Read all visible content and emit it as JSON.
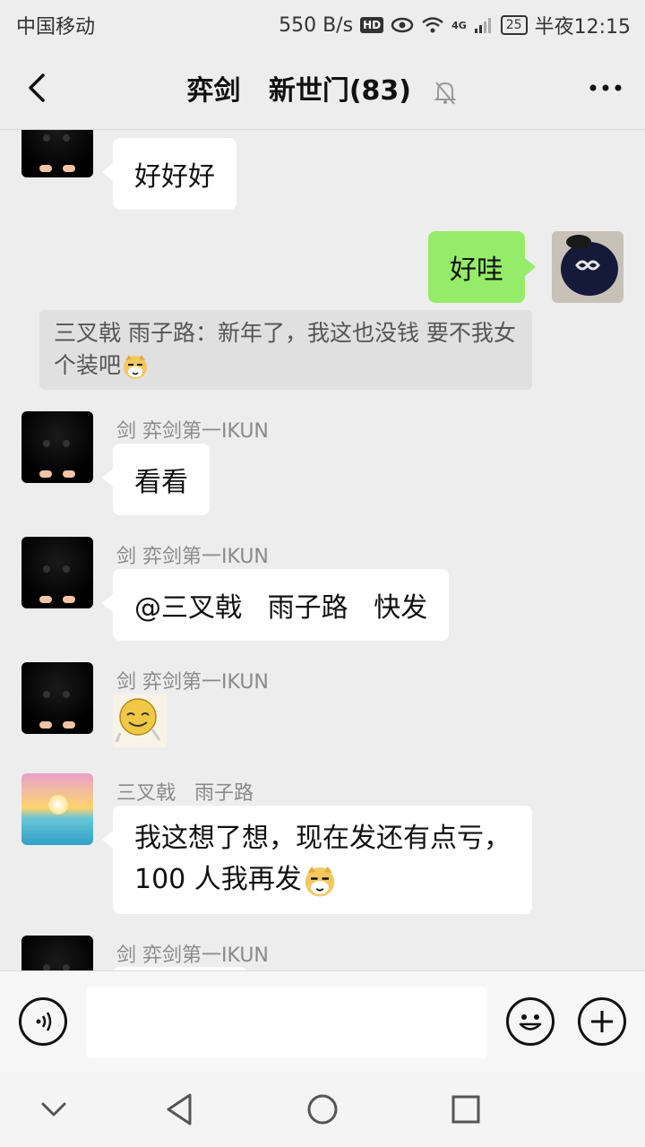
{
  "status_bar": {
    "carrier": "中国移动",
    "net_speed": "550 B/s",
    "hd": "HD",
    "signal_type": "4G",
    "battery": "25",
    "time": "半夜12:15"
  },
  "header": {
    "title": "弈剑   新世门(83)",
    "back_icon": "chevron-left-icon",
    "mute_icon": "bell-off-icon",
    "more_icon": "more-dots-icon"
  },
  "messages": [
    {
      "type": "received",
      "avatar": "cat",
      "sender": "",
      "text": "好好好"
    },
    {
      "type": "sent",
      "avatar": "me",
      "text": "好哇"
    },
    {
      "type": "quote",
      "text": "三叉戟   雨子路：新年了，我这也没钱 要不我女个装吧"
    },
    {
      "type": "received",
      "avatar": "cat",
      "sender": "剑 弈剑第一IKUN",
      "text": "看看"
    },
    {
      "type": "received",
      "avatar": "cat",
      "sender": "剑 弈剑第一IKUN",
      "text": "@三叉戟   雨子路   快发"
    },
    {
      "type": "received",
      "avatar": "cat",
      "sender": "剑 弈剑第一IKUN",
      "sticker": "smiley-sticker"
    },
    {
      "type": "received",
      "avatar": "sunset",
      "sender": "三叉戟   雨子路",
      "text_line1": "我这想了想，现在发还有点亏，",
      "text_line2": "100 人我再发"
    },
    {
      "type": "received",
      "avatar": "cat",
      "sender": "剑 弈剑第一IKUN",
      "text": ""
    }
  ],
  "input_bar": {
    "voice_icon": "voice-icon",
    "text_value": "",
    "emoji_icon": "emoji-icon",
    "plus_icon": "plus-icon"
  },
  "system_nav": {
    "icons": [
      "hide-keyboard-icon",
      "back-triangle-icon",
      "home-circle-icon",
      "recents-square-icon"
    ]
  }
}
